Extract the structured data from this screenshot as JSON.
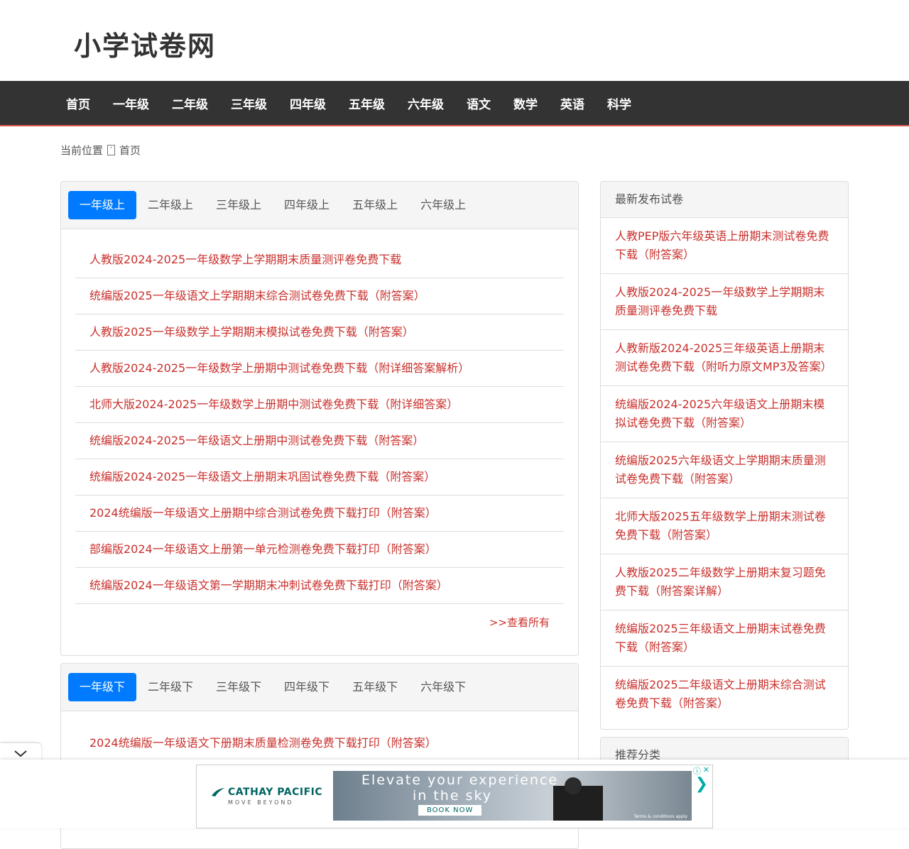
{
  "site": {
    "title": "小学试卷网"
  },
  "nav": {
    "items": [
      "首页",
      "一年级",
      "二年级",
      "三年级",
      "四年级",
      "五年级",
      "六年级",
      "语文",
      "数学",
      "英语",
      "科学"
    ]
  },
  "breadcrumb": {
    "label": "当前位置",
    "current": "首页"
  },
  "panel1": {
    "tabs": [
      "一年级上",
      "二年级上",
      "三年级上",
      "四年级上",
      "五年级上",
      "六年级上"
    ],
    "items": [
      "人教版2024-2025一年级数学上学期期末质量测评卷免费下载",
      "统编版2025一年级语文上学期期末综合测试卷免费下载（附答案）",
      "人教版2025一年级数学上学期期末模拟试卷免费下载（附答案）",
      "人教版2024-2025一年级数学上册期中测试卷免费下载（附详细答案解析）",
      "北师大版2024-2025一年级数学上册期中测试卷免费下载（附详细答案）",
      "统编版2024-2025一年级语文上册期中测试卷免费下载（附答案）",
      "统编版2024-2025一年级语文上册期末巩固试卷免费下载（附答案）",
      "2024统编版一年级语文上册期中综合测试卷免费下载打印（附答案）",
      "部编版2024一年级语文上册第一单元检测卷免费下载打印（附答案）",
      "统编版2024一年级语文第一学期期末冲刺试卷免费下载打印（附答案）"
    ],
    "more": ">>查看所有"
  },
  "panel2": {
    "tabs": [
      "一年级下",
      "二年级下",
      "三年级下",
      "四年级下",
      "五年级下",
      "六年级下"
    ],
    "items": [
      "2024统编版一年级语文下册期末质量检测卷免费下载打印（附答案）"
    ]
  },
  "sidebar": {
    "latest_title": "最新发布试卷",
    "latest": [
      "人教PEP版六年级英语上册期末测试卷免费下载（附答案）",
      "人教版2024-2025一年级数学上学期期末质量测评卷免费下载",
      "人教新版2024-2025三年级英语上册期末测试卷免费下载（附听力原文MP3及答案）",
      "统编版2024-2025六年级语文上册期末模拟试卷免费下载（附答案）",
      "统编版2025六年级语文上学期期末质量测试卷免费下载（附答案）",
      "北师大版2025五年级数学上册期末测试卷免费下载（附答案）",
      "人教版2025二年级数学上册期末复习题免费下载（附答案详解）",
      "统编版2025三年级语文上册期末试卷免费下载（附答案）",
      "统编版2025二年级语文上册期末综合测试卷免费下载（附答案）"
    ],
    "recommend_title": "推荐分类"
  },
  "ad": {
    "brand": "CATHAY PACIFIC",
    "tagline": "MOVE BEYOND",
    "headline1": "Elevate your experience",
    "headline2": "in the sky",
    "button": "BOOK NOW",
    "terms": "Terms & conditions apply"
  },
  "colors": {
    "nav_bg": "#333333",
    "link": "#c9302c",
    "accent": "#007bff",
    "nav_border": "#d9534f"
  }
}
